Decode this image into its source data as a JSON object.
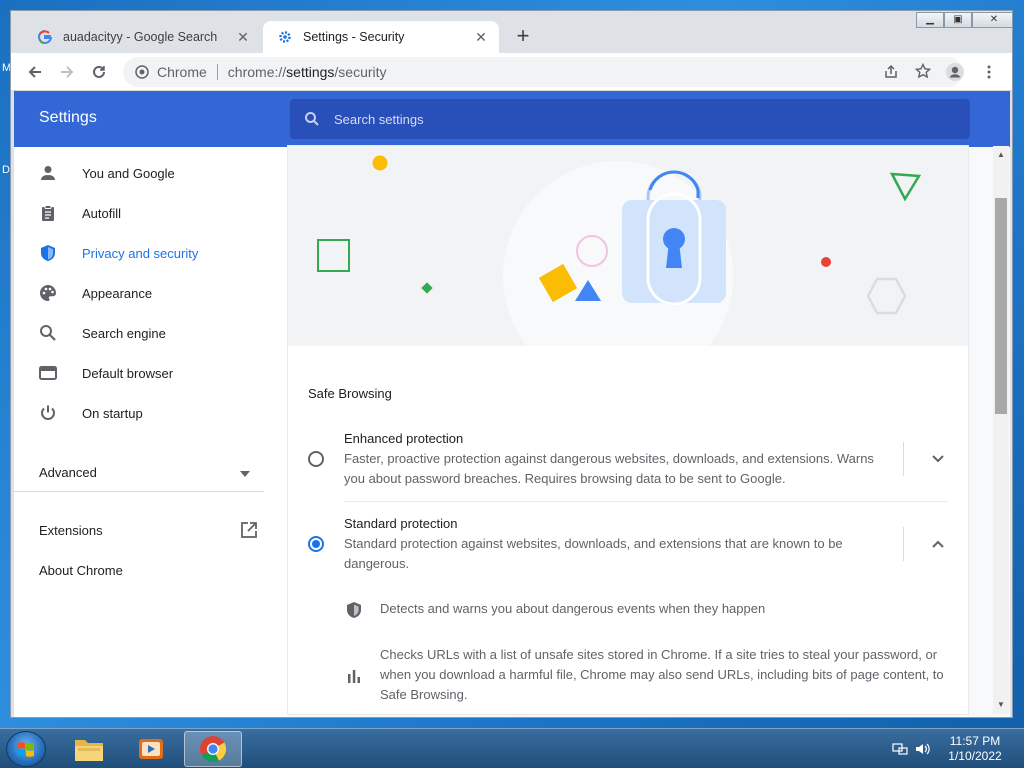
{
  "browser": {
    "tabs": [
      {
        "title": "auadacityy - Google Search",
        "icon": "google-g-icon",
        "active": false
      },
      {
        "title": "Settings - Security",
        "icon": "gear-icon",
        "active": true
      }
    ],
    "omnibox": {
      "site": "Chrome",
      "url_host": "chrome://",
      "url_main": "settings",
      "url_path": "/security"
    }
  },
  "settings": {
    "header_title": "Settings",
    "search_placeholder": "Search settings",
    "sidebar": {
      "items": [
        {
          "label": "You and Google",
          "icon": "person-icon"
        },
        {
          "label": "Autofill",
          "icon": "clipboard-icon"
        },
        {
          "label": "Privacy and security",
          "icon": "shield-icon",
          "selected": true
        },
        {
          "label": "Appearance",
          "icon": "palette-icon"
        },
        {
          "label": "Search engine",
          "icon": "search-icon"
        },
        {
          "label": "Default browser",
          "icon": "browser-window-icon"
        },
        {
          "label": "On startup",
          "icon": "power-icon"
        }
      ],
      "advanced": "Advanced",
      "extensions": "Extensions",
      "about": "About Chrome"
    },
    "safe_browsing": {
      "section_title": "Safe Browsing",
      "enhanced": {
        "title": "Enhanced protection",
        "description": "Faster, proactive protection against dangerous websites, downloads, and extensions. Warns you about password breaches. Requires browsing data to be sent to Google.",
        "selected": false
      },
      "standard": {
        "title": "Standard protection",
        "description": "Standard protection against websites, downloads, and extensions that are known to be dangerous.",
        "selected": true,
        "details": [
          "Detects and warns you about dangerous events when they happen",
          "Checks URLs with a list of unsafe sites stored in Chrome. If a site tries to steal your password, or when you download a harmful file, Chrome may also send URLs, including bits of page content, to Safe Browsing."
        ]
      }
    }
  },
  "desktop": {
    "labels": [
      "M",
      "D"
    ]
  },
  "taskbar": {
    "time": "11:57 PM",
    "date": "1/10/2022"
  },
  "colors": {
    "accent": "#1a73e8",
    "header": "#3367d6",
    "search_bg": "#2850b8"
  }
}
